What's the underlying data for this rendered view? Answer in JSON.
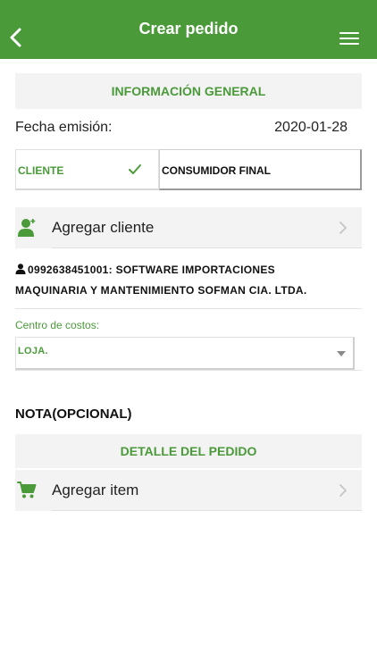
{
  "header": {
    "title": "Crear pedido"
  },
  "general": {
    "section_title": "INFORMACIÓN GENERAL",
    "fecha_label": "Fecha emisión:",
    "fecha_value": "2020-01-28",
    "segments": {
      "cliente": "CLIENTE",
      "consumidor": "CONSUMIDOR FINAL",
      "selected": "cliente"
    },
    "add_client_label": "Agregar cliente",
    "client_id_line": "0992638451001: SOFTWARE IMPORTACIONES",
    "client_name_line": "MAQUINARIA Y MANTENIMIENTO SOFMAN CIA. LTDA.",
    "centro_label": "Centro de costos:",
    "centro_value": "LOJA."
  },
  "nota": {
    "label": "NOTA(OPCIONAL)"
  },
  "detalle": {
    "section_title": "DETALLE DEL PEDIDO",
    "add_item_label": "Agregar item"
  },
  "colors": {
    "accent": "#4a9a3a",
    "row_bg": "#f3f3f3"
  },
  "icons": [
    "back-icon",
    "menu-icon",
    "check-icon",
    "add-user-icon",
    "chevron-right-icon",
    "person-icon",
    "dropdown-icon",
    "cart-icon"
  ]
}
